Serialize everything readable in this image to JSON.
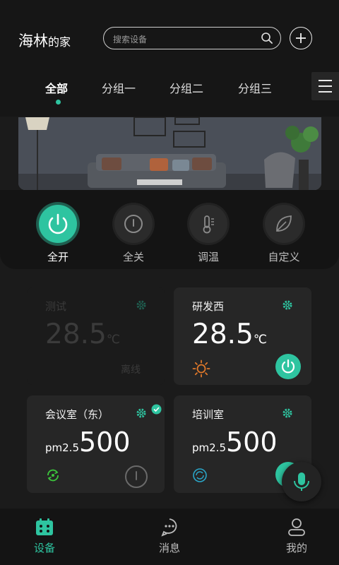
{
  "header": {
    "title_main": "海林",
    "title_suffix": "的家",
    "search_placeholder": "搜索设备",
    "tabs": [
      "全部",
      "分组一",
      "分组二",
      "分组三"
    ]
  },
  "quick_actions": [
    {
      "label": "全开",
      "icon": "power-icon"
    },
    {
      "label": "全关",
      "icon": "power-off-icon"
    },
    {
      "label": "调温",
      "icon": "thermometer-icon"
    },
    {
      "label": "自定义",
      "icon": "leaf-icon"
    }
  ],
  "devices": [
    {
      "name": "测试",
      "temperature": "28.5",
      "unit": "℃",
      "status": "离线"
    },
    {
      "name": "研发西",
      "temperature": "28.5",
      "unit": "℃",
      "mode_icon": "sun-icon"
    },
    {
      "name": "会议室（东）",
      "pm_label": "pm2.5",
      "pm_value": "500",
      "mode_icon": "recycle-icon"
    },
    {
      "name": "培训室",
      "pm_label": "pm2.5",
      "pm_value": "500",
      "mode_icon": "refresh-icon"
    }
  ],
  "bottom_nav": [
    {
      "label": "设备",
      "icon": "device-grid-icon"
    },
    {
      "label": "消息",
      "icon": "message-icon"
    },
    {
      "label": "我的",
      "icon": "user-icon"
    }
  ],
  "colors": {
    "accent": "#2ec4a0",
    "background": "#1b1b1b",
    "card": "#262626",
    "sun": "#e0782a"
  }
}
